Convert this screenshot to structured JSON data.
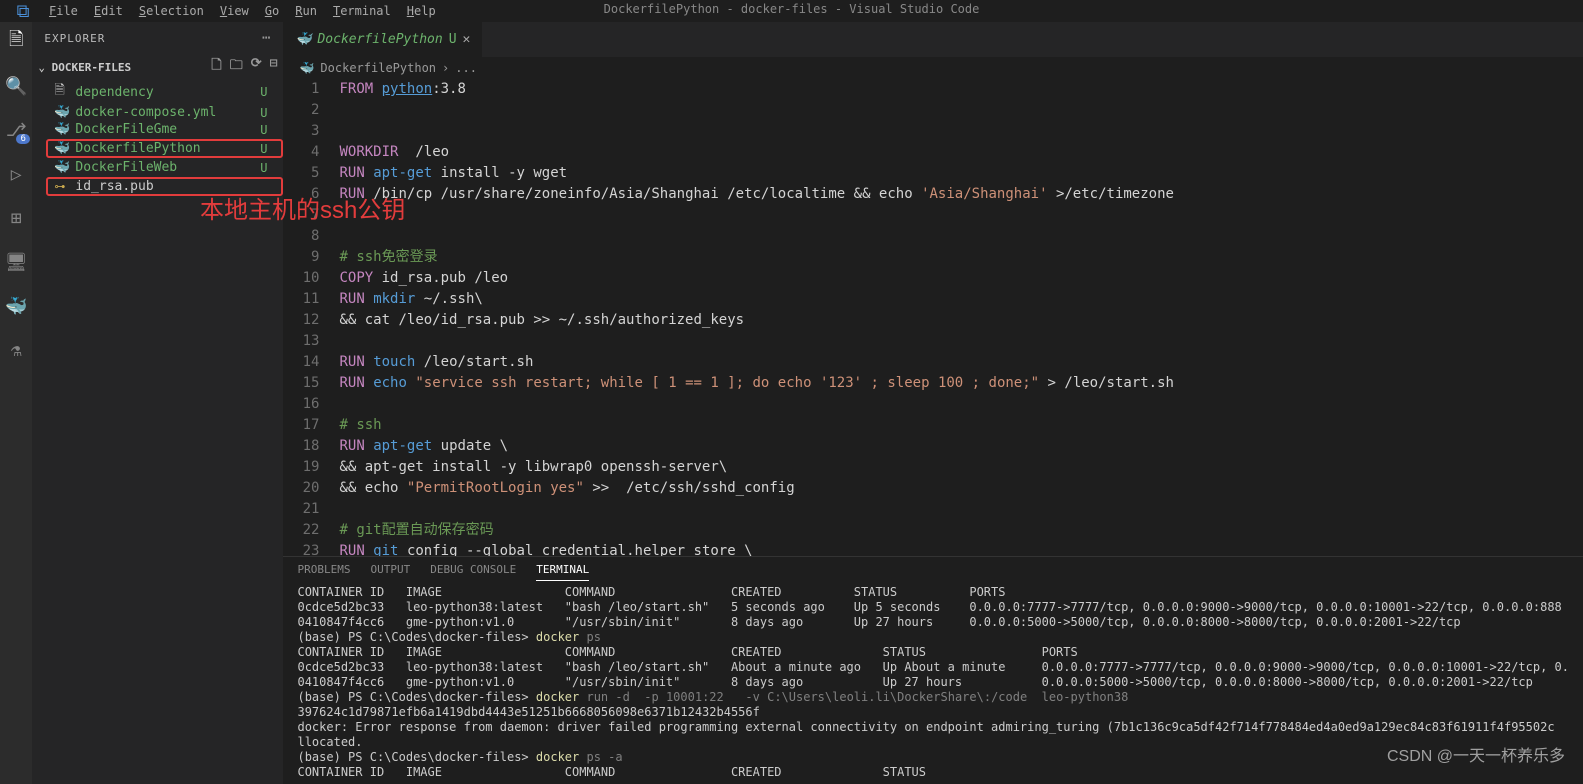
{
  "window_title": "DockerfilePython - docker-files - Visual Studio Code",
  "menu": [
    "File",
    "Edit",
    "Selection",
    "View",
    "Go",
    "Run",
    "Terminal",
    "Help"
  ],
  "sidebar": {
    "title": "EXPLORER",
    "folder": "DOCKER-FILES",
    "files": [
      {
        "name": "dependency",
        "status": "U",
        "icon": "file",
        "cls": "untracked"
      },
      {
        "name": "docker-compose.yml",
        "status": "U",
        "icon": "docker",
        "cls": "untracked"
      },
      {
        "name": "DockerFileGme",
        "status": "U",
        "icon": "docker",
        "cls": "untracked"
      },
      {
        "name": "DockerfilePython",
        "status": "U",
        "icon": "docker",
        "cls": "untracked",
        "selected": true
      },
      {
        "name": "DockerFileWeb",
        "status": "U",
        "icon": "docker",
        "cls": "untracked"
      },
      {
        "name": "id_rsa.pub",
        "status": "",
        "icon": "key",
        "cls": "",
        "selected": true
      }
    ]
  },
  "source_control_badge": "6",
  "annotation": "本地主机的ssh公钥",
  "tab": {
    "name": "DockerfilePython",
    "status": "U"
  },
  "breadcrumb": {
    "file": "DockerfilePython",
    "sep": "›",
    "more": "..."
  },
  "code": [
    {
      "n": 1,
      "html": "<span class='kw'>FROM</span> <span class='link'>python</span><span class='op'>:3.8</span>"
    },
    {
      "n": 2,
      "html": ""
    },
    {
      "n": 3,
      "html": ""
    },
    {
      "n": 4,
      "html": "<span class='kw'>WORKDIR</span>  <span class='op'>/leo</span>"
    },
    {
      "n": 5,
      "html": "<span class='kw'>RUN</span> <span class='var'>apt-get</span> <span class='op'>install -y wget</span>"
    },
    {
      "n": 6,
      "html": "<span class='kw'>RUN</span> <span class='op'>/bin/cp /usr/share/zoneinfo/Asia/Shanghai /etc/localtime && echo </span><span class='str'>'Asia/Shanghai'</span> <span class='op'>&gt;/etc/timezone</span>"
    },
    {
      "n": 7,
      "html": ""
    },
    {
      "n": 8,
      "html": ""
    },
    {
      "n": 9,
      "html": "<span class='cmt'># ssh免密登录</span>"
    },
    {
      "n": 10,
      "html": "<span class='kw'>COPY</span> <span class='op'>id_rsa.pub /leo</span>"
    },
    {
      "n": 11,
      "html": "<span class='kw'>RUN</span> <span class='var'>mkdir</span> <span class='op'>~/.ssh\\</span>"
    },
    {
      "n": 12,
      "html": "<span class='op'>&& cat /leo/id_rsa.pub &gt;&gt; ~/.ssh/authorized_keys</span>"
    },
    {
      "n": 13,
      "html": ""
    },
    {
      "n": 14,
      "html": "<span class='kw'>RUN</span> <span class='var'>touch</span> <span class='op'>/leo/start.sh</span>"
    },
    {
      "n": 15,
      "html": "<span class='kw'>RUN</span> <span class='var'>echo</span> <span class='str'>\"service ssh restart; while [ 1 == 1 ]; do echo '123' ; sleep 100 ; done;\"</span> <span class='op'>&gt; /leo/start.sh</span>"
    },
    {
      "n": 16,
      "html": ""
    },
    {
      "n": 17,
      "html": "<span class='cmt'># ssh</span>"
    },
    {
      "n": 18,
      "html": "<span class='kw'>RUN</span> <span class='var'>apt-get</span> <span class='op'>update \\</span>"
    },
    {
      "n": 19,
      "html": "<span class='op'>&& apt-get install -y libwrap0 openssh-server\\</span>"
    },
    {
      "n": 20,
      "html": "<span class='op'>&& echo </span><span class='str'>\"PermitRootLogin yes\"</span> <span class='op'>&gt;&gt;  /etc/ssh/sshd_config</span>"
    },
    {
      "n": 21,
      "html": ""
    },
    {
      "n": 22,
      "html": "<span class='cmt'># git配置自动保存密码</span>"
    },
    {
      "n": 23,
      "html": "<span class='kw'>RUN</span> <span class='var'>git</span> <span class='op'>config --global credential.helper store \\</span>"
    }
  ],
  "panel": {
    "tabs": [
      "PROBLEMS",
      "OUTPUT",
      "DEBUG CONSOLE",
      "TERMINAL"
    ],
    "active": "TERMINAL",
    "terminal_lines": [
      "CONTAINER ID   IMAGE                 COMMAND                CREATED          STATUS          PORTS",
      "0cdce5d2bc33   leo-python38:latest   \"bash /leo/start.sh\"   5 seconds ago    Up 5 seconds    0.0.0.0:7777->7777/tcp, 0.0.0.0:9000->9000/tcp, 0.0.0.0:10001->22/tcp, 0.0.0.0:888",
      "0410847f4cc6   gme-python:v1.0       \"/usr/sbin/init\"       8 days ago       Up 27 hours     0.0.0.0:5000->5000/tcp, 0.0.0.0:8000->8000/tcp, 0.0.0.0:2001->22/tcp",
      "(base) PS C:\\Codes\\docker-files> <cmd>docker</cmd> <gray>ps</gray>",
      "CONTAINER ID   IMAGE                 COMMAND                CREATED              STATUS                PORTS",
      "0cdce5d2bc33   leo-python38:latest   \"bash /leo/start.sh\"   About a minute ago   Up About a minute     0.0.0.0:7777->7777/tcp, 0.0.0.0:9000->9000/tcp, 0.0.0.0:10001->22/tcp, 0.",
      "0410847f4cc6   gme-python:v1.0       \"/usr/sbin/init\"       8 days ago           Up 27 hours           0.0.0.0:5000->5000/tcp, 0.0.0.0:8000->8000/tcp, 0.0.0.0:2001->22/tcp",
      "(base) PS C:\\Codes\\docker-files> <cmd>docker</cmd> <gray>run -d  -p 10001:22   -v C:\\Users\\leoli.li\\DockerShare\\:/code  leo-python38</gray>",
      "397624c1d79871efb6a1419dbd4443e51251b6668056098e6371b12432b4556f",
      "docker: Error response from daemon: driver failed programming external connectivity on endpoint admiring_turing (7b1c136c9ca5df42f714f778484ed4a0ed9a129ec84c83f61911f4f95502c",
      "llocated.",
      "(base) PS C:\\Codes\\docker-files> <cmd>docker</cmd> <gray>ps -a</gray>",
      "CONTAINER ID   IMAGE                 COMMAND                CREATED              STATUS"
    ]
  },
  "watermark": "CSDN @一天一杯养乐多"
}
